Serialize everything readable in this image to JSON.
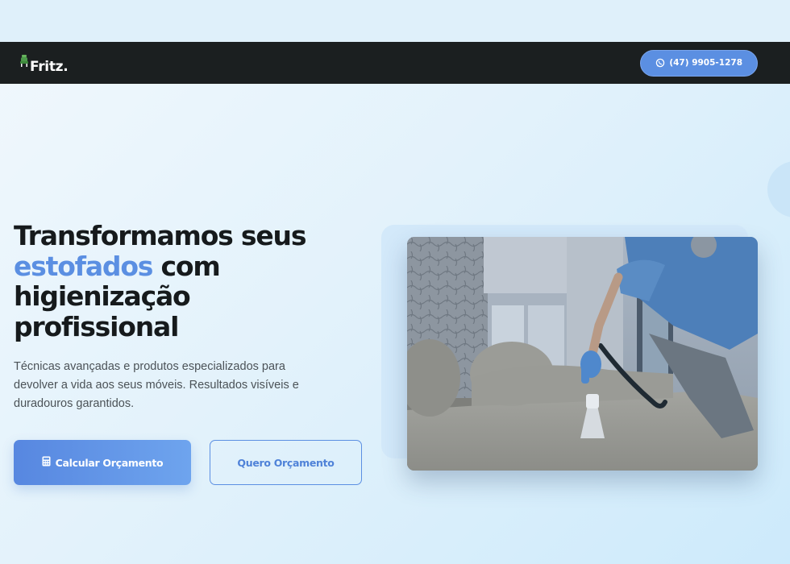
{
  "brand": {
    "name": "Fritz.",
    "logo_icon": "armchair-mark-icon"
  },
  "header": {
    "phone_label": "(47) 9905-1278",
    "phone_icon": "whatsapp-icon"
  },
  "hero": {
    "title_line1": "Transformamos seus",
    "title_accent": "estofados",
    "title_after_accent": " com",
    "title_line3": "higienização",
    "title_line4": "profissional",
    "description": "Técnicas avançadas e produtos especializados para devolver a vida aos seus móveis. Resultados visíveis e duradouros garantidos.",
    "primary_cta": "Calcular Orçamento",
    "primary_cta_icon": "calculator-icon",
    "secondary_cta": "Quero Orçamento"
  },
  "colors": {
    "accent": "#5b8fe2",
    "navbar": "#1b1f20",
    "title": "#161a1c",
    "body_text": "#4b5257"
  }
}
